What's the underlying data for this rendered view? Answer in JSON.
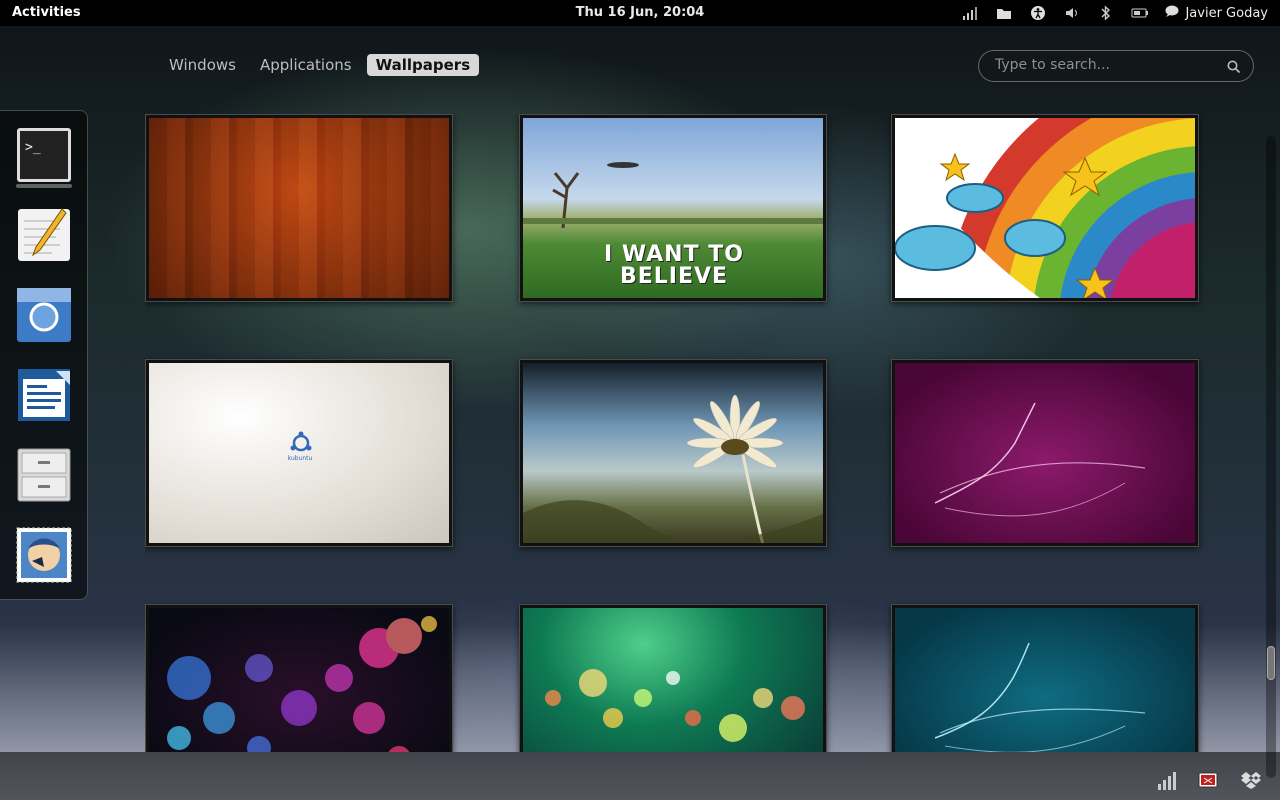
{
  "topbar": {
    "activities_label": "Activities",
    "clock": "Thu 16 Jun, 20:04",
    "user_name": "Javier Goday",
    "tray_icons": [
      "signal-icon",
      "folder-icon",
      "accessibility-icon",
      "volume-icon",
      "bluetooth-icon",
      "battery-icon",
      "chat-icon"
    ]
  },
  "view_tabs": [
    {
      "label": "Windows",
      "active": false
    },
    {
      "label": "Applications",
      "active": false
    },
    {
      "label": "Wallpapers",
      "active": true
    }
  ],
  "search": {
    "placeholder": "Type to search..."
  },
  "dash": {
    "items": [
      {
        "name": "terminal-icon",
        "running": true
      },
      {
        "name": "text-editor-icon",
        "running": false
      },
      {
        "name": "chromium-icon",
        "running": false
      },
      {
        "name": "writer-icon",
        "running": false
      },
      {
        "name": "file-cabinet-icon",
        "running": false
      },
      {
        "name": "mail-client-icon",
        "running": false
      }
    ]
  },
  "wallpapers": [
    {
      "id": "wood",
      "text": ""
    },
    {
      "id": "i-want-to-believe",
      "text_line1": "I WANT TO",
      "text_line2": "BELIEVE"
    },
    {
      "id": "rainbow-stars",
      "text": ""
    },
    {
      "id": "kubuntu",
      "text": "kubuntu"
    },
    {
      "id": "flower",
      "text": ""
    },
    {
      "id": "magenta-swirl",
      "text": ""
    },
    {
      "id": "bokeh-pink-blue",
      "text": ""
    },
    {
      "id": "bokeh-green",
      "text": ""
    },
    {
      "id": "teal-swirl",
      "text": ""
    }
  ],
  "bottom_tray_icons": [
    "network-bars-icon",
    "screen-record-icon",
    "dropbox-icon"
  ],
  "colors": {
    "topbar": "#000000",
    "active_tab_bg": "#d8d8d8"
  }
}
